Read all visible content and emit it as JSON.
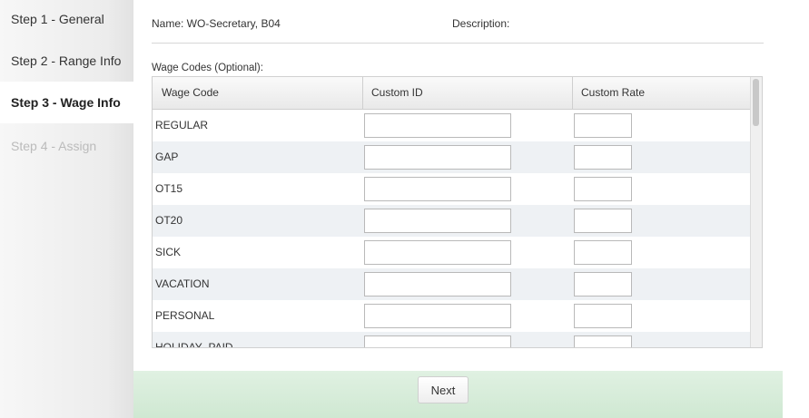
{
  "sidebar": {
    "steps": [
      {
        "label": "Step 1 - General"
      },
      {
        "label": "Step 2 - Range Info"
      },
      {
        "label": "Step 3 - Wage Info"
      },
      {
        "label": "Step 4 - Assign"
      }
    ]
  },
  "form": {
    "name": "Name: WO-Secretary, B04",
    "description": "Description:",
    "wage_codes_label": "Wage Codes (Optional):"
  },
  "grid": {
    "columns": [
      "Wage Code",
      "Custom ID",
      "Custom Rate"
    ],
    "rows": [
      {
        "code": "REGULAR",
        "custom_id": "",
        "custom_rate": ""
      },
      {
        "code": "GAP",
        "custom_id": "",
        "custom_rate": ""
      },
      {
        "code": "OT15",
        "custom_id": "",
        "custom_rate": ""
      },
      {
        "code": "OT20",
        "custom_id": "",
        "custom_rate": ""
      },
      {
        "code": "SICK",
        "custom_id": "",
        "custom_rate": ""
      },
      {
        "code": "VACATION",
        "custom_id": "",
        "custom_rate": ""
      },
      {
        "code": "PERSONAL",
        "custom_id": "",
        "custom_rate": ""
      },
      {
        "code": "HOLIDAY_PAID",
        "custom_id": "",
        "custom_rate": ""
      }
    ]
  },
  "footer": {
    "next_label": "Next"
  },
  "colors": {
    "footer_bg": "#d6ecd8",
    "disabled_step": "#bbbbbb",
    "alt_row": "#eef1f4"
  }
}
